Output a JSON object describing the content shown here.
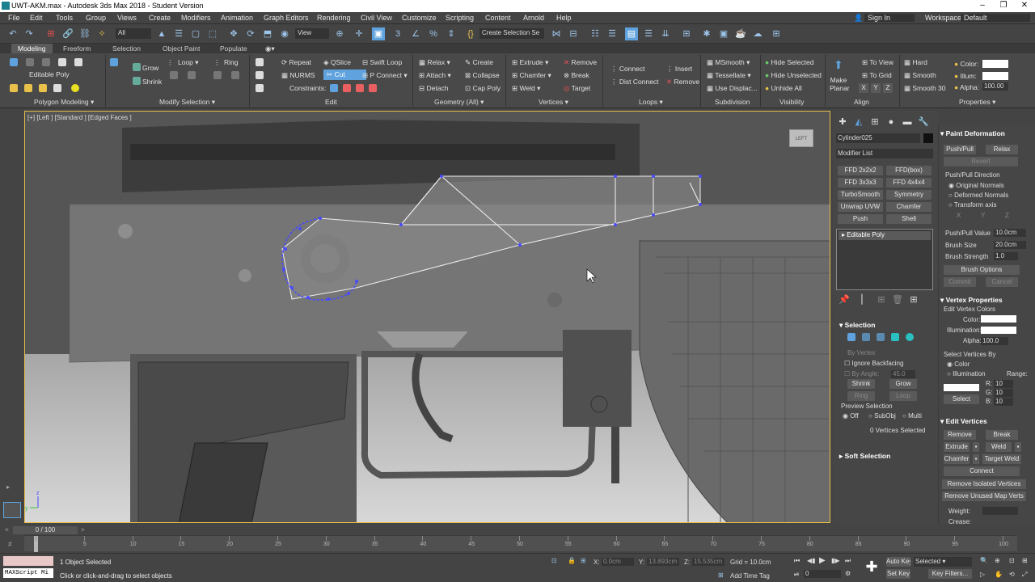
{
  "window": {
    "title": "UWT-AKM.max - Autodesk 3ds Max 2018 - Student Version"
  },
  "menu": [
    "File",
    "Edit",
    "Tools",
    "Group",
    "Views",
    "Create",
    "Modifiers",
    "Animation",
    "Graph Editors",
    "Rendering",
    "Civil View",
    "Customize",
    "Scripting",
    "Content",
    "Arnold",
    "Help"
  ],
  "account": {
    "signin": "Sign In",
    "workspaces_label": "Workspaces:",
    "workspace": "Default"
  },
  "toolbar": {
    "filter": "All",
    "view": "View",
    "selection_set": "Create Selection Se"
  },
  "ribbon_tabs": [
    "Modeling",
    "Freeform",
    "Selection",
    "Object Paint",
    "Populate"
  ],
  "ribbon": {
    "editable_poly": "Editable Poly",
    "polygon_modeling": "Polygon Modeling",
    "grow": "Grow",
    "shrink": "Shrink",
    "loop": "Loop",
    "ring": "Ring",
    "modify_selection": "Modify Selection",
    "repeat": "Repeat",
    "qslice": "QSlice",
    "swift_loop": "Swift Loop",
    "nurms": "NURMS",
    "cut": "Cut",
    "p_connect": "P Connect",
    "constraints": "Constraints:",
    "edit": "Edit",
    "relax": "Relax",
    "create": "Create",
    "attach": "Attach",
    "collapse": "Collapse",
    "detach": "Detach",
    "cap_poly": "Cap Poly",
    "geometry_all": "Geometry (All)",
    "extrude": "Extrude",
    "remove": "Remove",
    "chamfer": "Chamfer",
    "break": "Break",
    "weld": "Weld",
    "target": "Target",
    "vertices": "Vertices",
    "connect": "Connect",
    "insert": "Insert",
    "dist_connect": "Dist Connect",
    "remove2": "Remove",
    "loops": "Loops",
    "msmooth": "MSmooth",
    "tessellate": "Tessellate",
    "use_displac": "Use Displac...",
    "subdivision": "Subdivision",
    "hide_selected": "Hide Selected",
    "hide_unselected": "Hide Unselected",
    "unhide_all": "Unhide All",
    "visibility": "Visibility",
    "make_planar": "Make Planar",
    "to_view": "To View",
    "to_grid": "To Grid",
    "x": "X",
    "y": "Y",
    "z": "Z",
    "align": "Align",
    "hard": "Hard",
    "smooth": "Smooth",
    "smooth30": "Smooth 30",
    "color": "Color:",
    "illum": "Illum:",
    "alpha": "Alpha:",
    "alpha_val": "100.00",
    "properties": "Properties"
  },
  "viewport": {
    "label": "[+] [Left ] [Standard ] [Edged Faces ]",
    "cube": "LEFT"
  },
  "command_panel": {
    "object_name": "Cylinder025",
    "modifier_list": "Modifier List",
    "mod_buttons": [
      "FFD 2x2x2",
      "FFD(box)",
      "FFD 3x3x3",
      "FFD 4x4x4",
      "TurboSmooth",
      "Symmetry",
      "Unwrap UVW",
      "Chamfer",
      "Push",
      "Shell"
    ],
    "stack_item": "Editable Poly",
    "selection": "Selection",
    "by_vertex": "By Vertex",
    "ignore_backfacing": "Ignore Backfacing",
    "by_angle": "By Angle:",
    "by_angle_val": "45.0",
    "shrink": "Shrink",
    "grow": "Grow",
    "ring": "Ring",
    "loop": "Loop",
    "preview_selection": "Preview Selection",
    "off": "Off",
    "subobj": "SubObj",
    "multi": "Multi",
    "vertices_selected": "0 Vertices Selected",
    "soft_selection": "Soft Selection"
  },
  "right_panel": {
    "paint_deformation": "Paint Deformation",
    "push_pull": "Push/Pull",
    "relax": "Relax",
    "revert": "Revert",
    "push_pull_direction": "Push/Pull Direction",
    "original_normals": "Original Normals",
    "deformed_normals": "Deformed Normals",
    "transform_axis": "Transform axis",
    "x": "X",
    "y": "Y",
    "z": "Z",
    "push_pull_value": "Push/Pull Value",
    "push_pull_value_v": "10.0cm",
    "brush_size": "Brush Size",
    "brush_size_v": "20.0cm",
    "brush_strength": "Brush Strength",
    "brush_strength_v": "1.0",
    "brush_options": "Brush Options",
    "commit": "Commit",
    "cancel": "Cancel",
    "vertex_properties": "Vertex Properties",
    "edit_vertex_colors": "Edit Vertex Colors",
    "color": "Color:",
    "illumination": "Illumination:",
    "alpha": "Alpha:",
    "alpha_v": "100.0",
    "select_vertices_by": "Select Vertices By",
    "vcolor": "Color",
    "villum": "Illumination",
    "range": "Range:",
    "r": "R:",
    "g": "G:",
    "b": "B:",
    "rv": "10",
    "gv": "10",
    "bv": "10",
    "select": "Select",
    "edit_vertices": "Edit Vertices",
    "remove": "Remove",
    "break": "Break",
    "extrude": "Extrude",
    "weld": "Weld",
    "chamfer": "Chamfer",
    "target_weld": "Target Weld",
    "connect": "Connect",
    "remove_isolated": "Remove Isolated Vertices",
    "remove_unused": "Remove Unused Map Verts",
    "weight": "Weight:",
    "crease": "Crease:"
  },
  "timeline": {
    "frame": "0 / 100",
    "ticks": [
      "0",
      "5",
      "10",
      "15",
      "20",
      "25",
      "30",
      "35",
      "40",
      "45",
      "50",
      "55",
      "60",
      "65",
      "70",
      "75",
      "80",
      "85",
      "90",
      "95",
      "100"
    ]
  },
  "status": {
    "maxscript": "MAXScript Mi",
    "objects_selected": "1 Object Selected",
    "hint": "Click or click-and-drag to select objects",
    "x_label": "X:",
    "x_val": "0.0cm",
    "y_label": "Y:",
    "y_val": "13.893cm",
    "z_label": "Z:",
    "z_val": "15.535cm",
    "grid": "Grid = 10.0cm",
    "add_time_tag": "Add Time Tag",
    "auto_key": "Auto Key",
    "selected": "Selected",
    "set_key": "Set Key",
    "key_filters": "Key Filters...",
    "frame_field": "0"
  },
  "colors": {
    "accent": "#5fa2dd",
    "selection_border": "#e8c04a",
    "vertex_blue": "#4a4aff"
  }
}
